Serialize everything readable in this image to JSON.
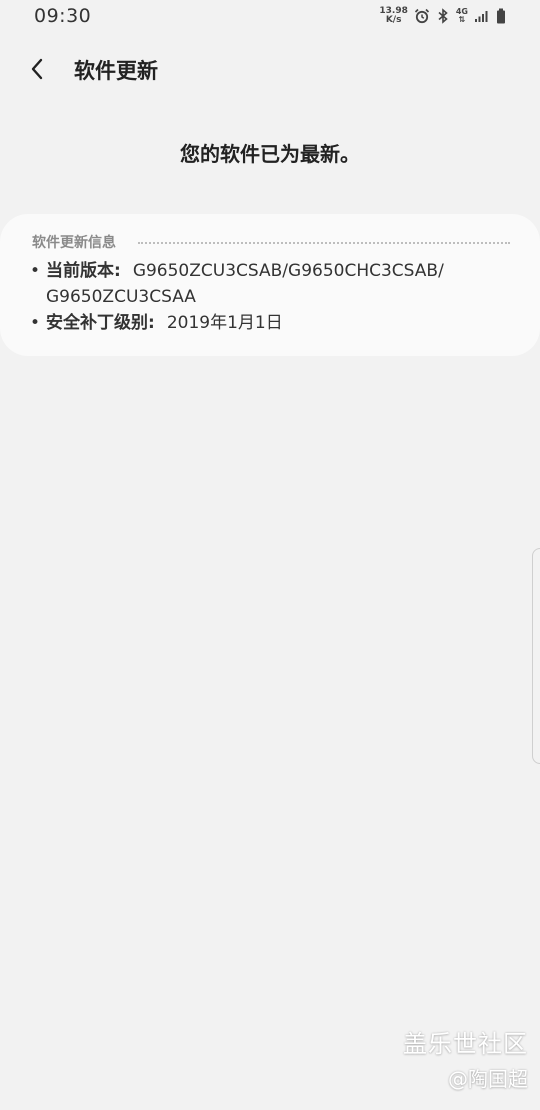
{
  "status_bar": {
    "time": "09:30",
    "net_speed_value": "13.98",
    "net_speed_unit": "K/s",
    "network_type": "4G"
  },
  "header": {
    "title": "软件更新"
  },
  "main": {
    "status_message": "您的软件已为最新。"
  },
  "info_card": {
    "title": "软件更新信息",
    "items": [
      {
        "label": "当前版本:",
        "value_line1": "G9650ZCU3CSAB/G9650CHC3CSAB/",
        "value_line2": "G9650ZCU3CSAA"
      },
      {
        "label": "安全补丁级别:",
        "value": "2019年1月1日"
      }
    ]
  },
  "watermark": {
    "line1": "盖乐世社区",
    "line2": "@陶国超"
  }
}
